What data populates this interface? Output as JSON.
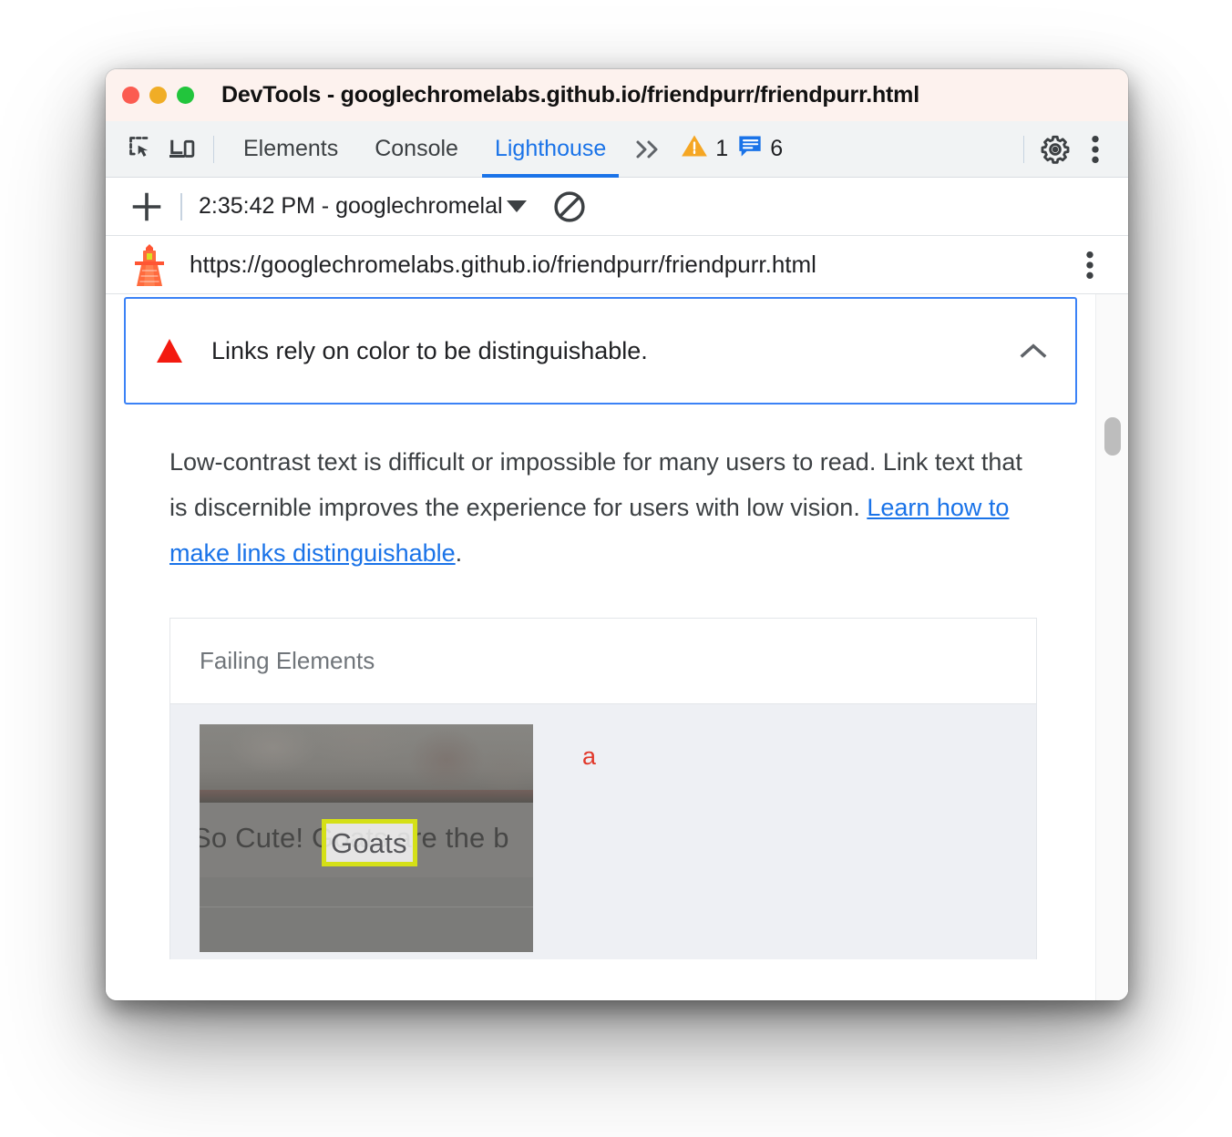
{
  "window": {
    "title": "DevTools - googlechromelabs.github.io/friendpurr/friendpurr.html",
    "traffic_lights": [
      {
        "name": "close",
        "color": "#fb5c51"
      },
      {
        "name": "minimize",
        "color": "#f0ad26"
      },
      {
        "name": "zoom",
        "color": "#22c53c"
      }
    ]
  },
  "tabstrip": {
    "icons": [
      {
        "name": "inspect-element-icon"
      },
      {
        "name": "device-toolbar-icon"
      }
    ],
    "tabs": [
      {
        "label": "Elements",
        "active": false
      },
      {
        "label": "Console",
        "active": false
      },
      {
        "label": "Lighthouse",
        "active": true
      }
    ],
    "more_tabs_label": "»",
    "warnings": {
      "icon": "warning-triangle-icon",
      "count": "1"
    },
    "messages": {
      "icon": "message-icon",
      "count": "6"
    },
    "settings_icon": "gear-icon",
    "menu_icon": "kebab-menu-icon",
    "accent": "#1a73e8"
  },
  "runbar": {
    "add_label": "+",
    "selected_run": "2:35:42 PM - googlechromelal",
    "dropdown_icon": "caret-down-icon",
    "clear_icon": "clear-all-icon"
  },
  "urlbar": {
    "brand_icon": "lighthouse-icon",
    "url": "https://googlechromelabs.github.io/friendpurr/friendpurr.html",
    "menu_icon": "kebab-menu-icon"
  },
  "audit": {
    "status_icon": "fail-triangle-icon",
    "status_color": "#f31a10",
    "title": "Links rely on color to be distinguishable.",
    "collapse_icon": "chevron-up-icon",
    "focus_border_color": "#3b82f6",
    "description_before": "Low-contrast text is difficult or impossible for many users to read. Link text that is discernible improves the experience for users with low vision. ",
    "description_link": "Learn how to make links distinguishable",
    "description_after": "."
  },
  "table": {
    "header": "Failing Elements",
    "rows": [
      {
        "snippet_text": "So Cute! Goats are the b",
        "highlighted_word": "Goats",
        "highlight_color": "#d5e017",
        "tag": "a",
        "tag_color": "#e1382a"
      }
    ]
  },
  "scrollbar": {
    "name": "report-scrollbar",
    "thumb_color": "#bdbdbd"
  }
}
